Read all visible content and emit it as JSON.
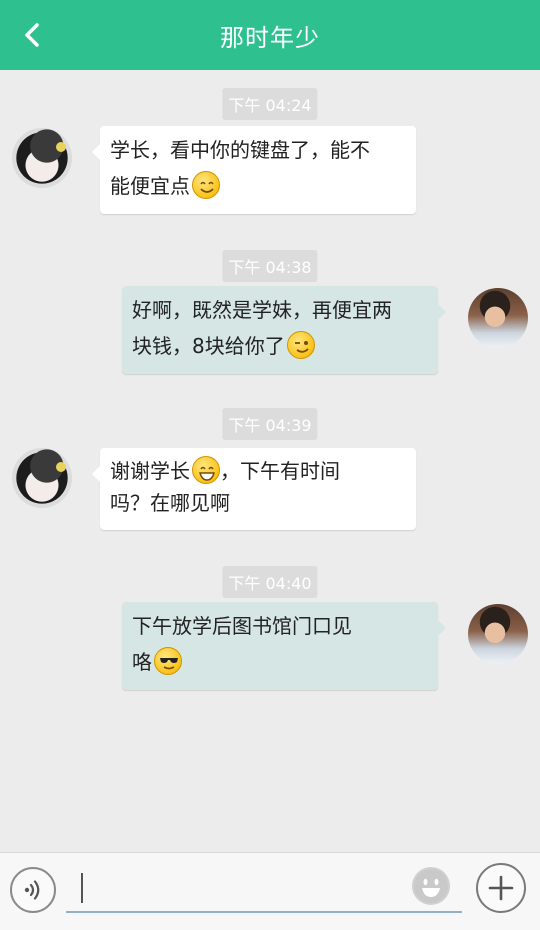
{
  "header": {
    "title": "那时年少",
    "back_icon": "chevron-left-icon",
    "background_color": "#2fc08f"
  },
  "messages": [
    {
      "timestamp": "下午 04:24",
      "side": "left",
      "lines": [
        "学长，看中你的键盘了，能不",
        "能便宜点"
      ],
      "emoji": "smile-emoji"
    },
    {
      "timestamp": "下午 04:38",
      "side": "right",
      "lines": [
        "好啊，既然是学妹，再便宜两",
        "块钱，8块给你了"
      ],
      "emoji": "wink-emoji"
    },
    {
      "timestamp": "下午 04:39",
      "side": "left",
      "line1_a": "谢谢学长",
      "line1_b": "，下午有时间",
      "line2": "吗？在哪见啊",
      "emoji": "grin-emoji"
    },
    {
      "timestamp": "下午 04:40",
      "side": "right",
      "lines": [
        "下午放学后图书馆门口见",
        "咯"
      ],
      "emoji": "sunglasses-emoji"
    }
  ],
  "input_bar": {
    "text_value": "",
    "voice_icon": "voice-icon",
    "emoji_icon": "emoji-icon",
    "plus_icon": "plus-icon"
  },
  "colors": {
    "left_bubble": "#ffffff",
    "right_bubble": "#d6e6e4",
    "chat_background": "#ececec"
  }
}
